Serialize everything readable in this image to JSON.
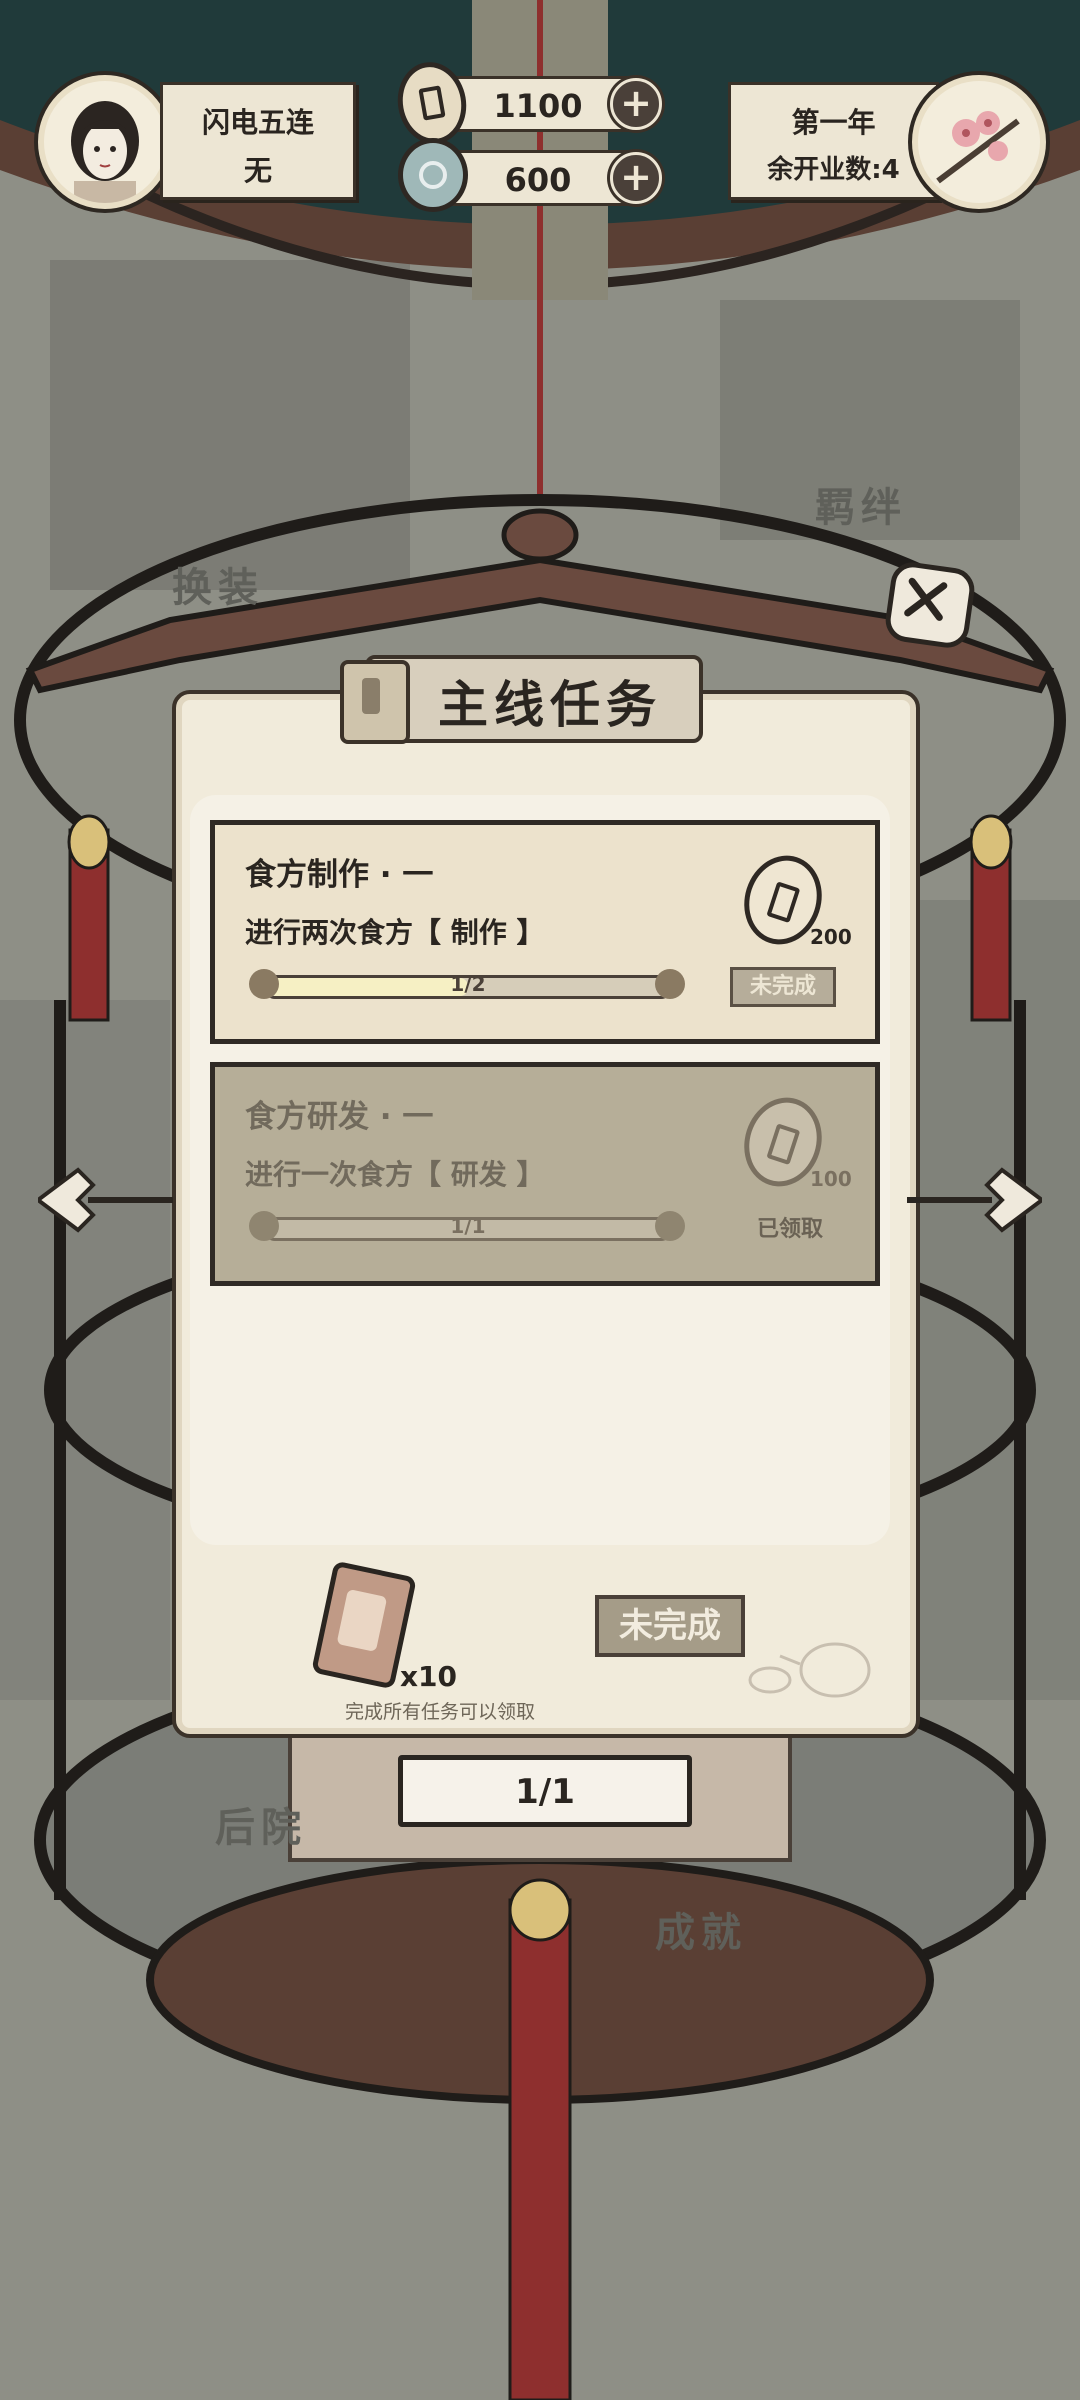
{
  "player": {
    "title": "闪电五连",
    "subtitle": "无"
  },
  "currency": {
    "coins": "1100",
    "jade": "600"
  },
  "season": {
    "year_label": "第一年",
    "remaining_label": "余开业数:4"
  },
  "background_labels": {
    "outfit": "换装",
    "bond": "羁绊",
    "backyard": "后院",
    "achievement": "成就"
  },
  "panel": {
    "title": "主线任务",
    "tasks": [
      {
        "name": "食方制作 · 一",
        "description": "进行两次食方【 制作 】",
        "progress_text": "1/2",
        "progress": 0.5,
        "reward": "200",
        "status": "未完成",
        "completed": false
      },
      {
        "name": "食方研发 · 一",
        "description": "进行一次食方【 研发 】",
        "progress_text": "1/1",
        "progress": 1.0,
        "reward": "100",
        "status": "已领取",
        "completed": true
      }
    ],
    "final_reward": {
      "count": "x10",
      "note": "完成所有任务可以领取",
      "button_label": "未完成"
    },
    "page_indicator": "1/1"
  },
  "colors": {
    "parchment": "#f1ebdb",
    "ink": "#2f2a25",
    "task_active_bg": "#ece2cc",
    "task_done_bg": "#b6ae98",
    "accent_red": "#8e2f2e"
  }
}
